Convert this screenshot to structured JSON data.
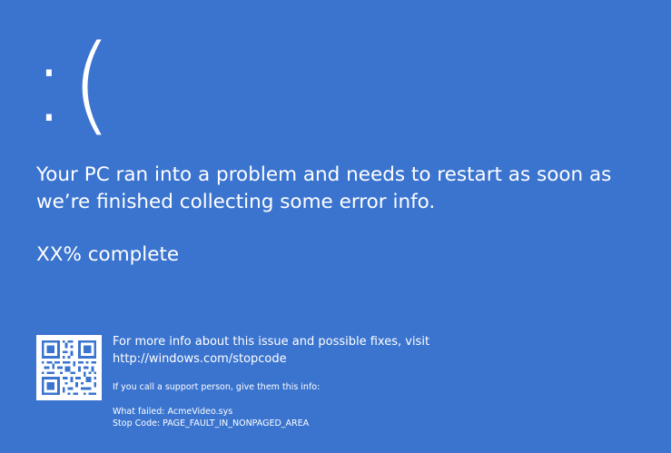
{
  "screen": {
    "background_color": "#3b74cf",
    "text_color": "#ffffff",
    "emoticon": ":(",
    "message": "Your PC ran into a problem and needs to restart as soon as we’re finished collecting some error info.",
    "progress_text": "XX% complete",
    "qr_code_icon": "qr-code",
    "more_info": {
      "line1": "For more info about this issue and possible fixes, visit",
      "url": "http://windows.com/stopcode"
    },
    "support_prompt": "If you call a support person, give them this info:",
    "details": {
      "what_failed_label": "What failed:",
      "what_failed_value": "AcmeVideo.sys",
      "stop_code_label": "Stop Code:",
      "stop_code_value": "PAGE_FAULT_IN_NONPAGED_AREA"
    }
  }
}
